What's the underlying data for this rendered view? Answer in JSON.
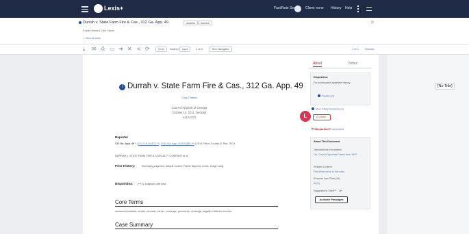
{
  "topbar": {
    "app_name": "Lexis+",
    "nav": [
      "Fact/Note Search",
      "Client: none",
      "History",
      "Help"
    ],
    "bg": "#1f2b46"
  },
  "doc": {
    "title": "Durrah v. State Farm Fire & Cas., 312 Ga. App. 49",
    "chip1": "Actions",
    "chip2": "Advisor",
    "folder": "Folder Name  |  Cert. None",
    "view_all": "< View all tabs"
  },
  "toolbar": {
    "icons": [
      "download-icon",
      "email-icon",
      "print-icon",
      "folder-icon",
      "forward-icon",
      "close-icon",
      "share-icon",
      "copy-icon"
    ],
    "sel1": "Go to",
    "search": "Search",
    "search_placeholder": "Input",
    "nav_text": "1 of 0",
    "sel2": "Term Navigator",
    "page_label": "1 of 1",
    "results": "Results"
  },
  "page": {
    "case_title": "Durrah v. State Farm Fire & Cas., 312 Ga. App. 49",
    "copy_cite": "Copy Citation",
    "court": "Court of Appeals of Georgia",
    "date": "October 14, 2011, Decided",
    "docket": "A11A1074",
    "reporter_label": "Reporter",
    "reporter_text_a": "312 Ga. App. 49 *",
    "reporter_link1": "717 S.E.2d 671 **",
    "reporter_link2": "2011 Ga. App. LEXIS 855 ***",
    "reporter_tail": "2011 Fulton County D. Rep. 3271",
    "parties": "DURRAH v. STATE FARM FIRE & CASUALTY COMPANY et al.",
    "prior_label": "Prior History:",
    "prior_text": "Summary judgment, default motion; Fulton Superior Court. Judge Long.",
    "disp_label": "Disposition:",
    "disp_text": "[***1] Judgment affirmed.",
    "core_terms": "Core Terms",
    "core_text": "uninsured motorist, tender, renewal, carrier, coverage, procedure, coverage, legally entitled to recover",
    "summary": "Case Summary"
  },
  "no_title": "[No Title]",
  "panel": {
    "tab_about": "About",
    "tab_notes": "Notes",
    "disp_head": "Disposition:",
    "disp_text": "For subsequent appellate history",
    "caution": "Caution (1)",
    "view_treat": "View Citing Decisions (4)",
    "badge": "L",
    "active_label": "Active",
    "shep_label": "Shepardize®",
    "shep_sub": "document",
    "about_head": "About This Document",
    "jurisdiction": "Jurisdictional Information",
    "jurisdiction_val": "Ga. Court of Appeals Cases from 1997",
    "related": "Related Content",
    "related_val": "Find references to this case",
    "request": "Request Law Clerk (AI)",
    "request_val": "Ai (0)",
    "suggest": "Suggestions Shelf™ - On",
    "activate": "Activate Passages"
  }
}
